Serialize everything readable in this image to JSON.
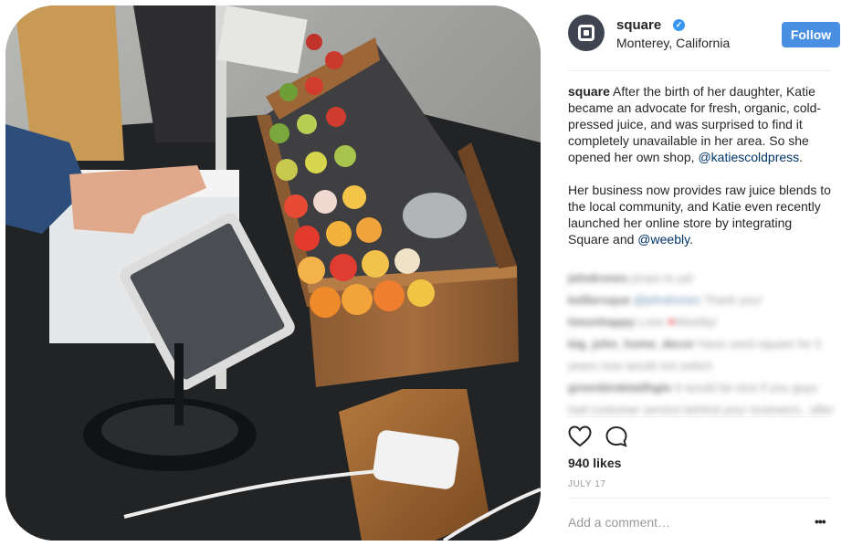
{
  "post": {
    "photo_label": "Juice cart with Square Stand and Reader",
    "author": {
      "username": "square",
      "verified_icon": "verified-badge-icon",
      "location": "Monterey, California",
      "follow_label": "Follow"
    },
    "caption": {
      "username": "square",
      "line1": "After the birth of her daughter, Katie became an advocate for fresh, organic, cold-pressed juice, and was surprised to find it completely unavailable in her area. So she opened her own shop, ",
      "mention1": "@katiescoldpress",
      "line1_end": ".",
      "line2": "Her business now provides raw juice blends to the local community, and Katie even recently launched her online store by integrating Square and ",
      "mention2": "@weebly",
      "line2_end": "."
    },
    "comments": [
      {
        "user": "jelndrones",
        "text": "props to ya!"
      },
      {
        "user": "kelliersque",
        "mention": "@jelndrones",
        "text": "Thank you!"
      },
      {
        "user": "timonhappy",
        "text": "Love",
        "after": "Weebly!"
      },
      {
        "user": "big_john_home_decor",
        "text": "Have used square for 5 years now would not switch"
      },
      {
        "user": "greenbirdetailhgtv",
        "text": "It would be nice if you guys had customer service behind your reviewers.. after basics do.ske kitted for a..."
      }
    ],
    "likes": "940 likes",
    "date": "JULY 17",
    "add_comment_placeholder": "Add a comment…",
    "more_label": "•••",
    "icons": {
      "like": "heart-icon",
      "comment": "comment-bubble-icon",
      "more": "more-options-icon"
    },
    "colors": {
      "follow_bg": "#4a90e2",
      "link": "#003569",
      "verified": "#3897f0",
      "avatar_bg": "#3e4550"
    }
  }
}
